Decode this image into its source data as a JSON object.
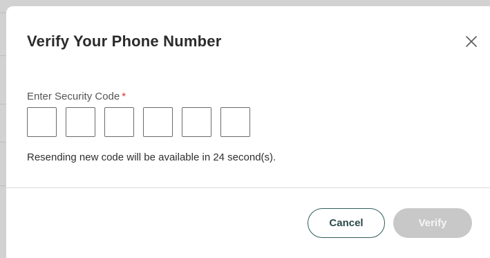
{
  "dialog": {
    "title": "Verify Your Phone Number",
    "close_icon": "close-icon",
    "code_label": "Enter Security Code",
    "required_marker": "*",
    "code_digits": [
      "",
      "",
      "",
      "",
      "",
      ""
    ],
    "resend_message": "Resending new code will be available in 24 second(s).",
    "cancel_label": "Cancel",
    "verify_label": "Verify",
    "verify_enabled": false
  },
  "colors": {
    "required": "#e02d2d",
    "cancel_border": "#2f5c5c",
    "verify_disabled_bg": "#c8c8c8",
    "backdrop": "#d2d2d2"
  }
}
